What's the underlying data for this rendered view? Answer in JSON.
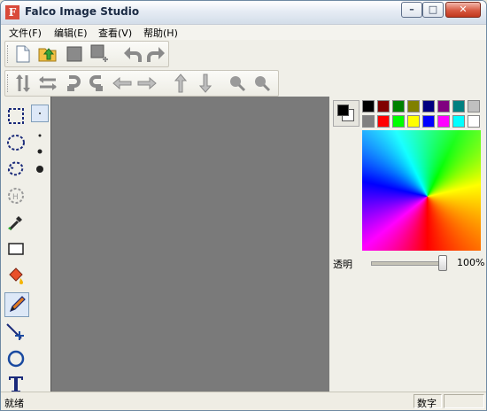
{
  "window": {
    "title": "Falco Image Studio",
    "minimize": "–",
    "maximize": "□",
    "close": "✕"
  },
  "menu": [
    "文件(F)",
    "编辑(E)",
    "查看(V)",
    "帮助(H)"
  ],
  "toolbar1": [
    "new-file-icon",
    "open-folder-icon",
    "save-icon",
    "save-as-icon",
    "undo-icon",
    "redo-icon"
  ],
  "toolbar2": [
    "flip-vertical-icon",
    "flip-horizontal-icon",
    "rotate-left-icon",
    "rotate-right-icon",
    "arrow-left-icon",
    "arrow-right-icon",
    "arrow-up-icon",
    "arrow-down-icon",
    "zoom-in-icon",
    "zoom-out-icon"
  ],
  "tools": [
    "rect-select-icon",
    "ellipse-select-icon",
    "lasso-select-icon",
    "magic-wand-icon",
    "eyedropper-icon",
    "rectangle-icon",
    "fill-bucket-icon",
    "pencil-icon",
    "line-icon",
    "ellipse-icon",
    "text-icon"
  ],
  "brush_sizes": [
    "brush-size-1",
    "brush-size-2",
    "brush-size-3",
    "brush-size-4"
  ],
  "palette": {
    "foreground": "#000000",
    "background": "#ffffff",
    "row1": [
      "#000000",
      "#800000",
      "#008000",
      "#808000",
      "#000080",
      "#800080",
      "#008080",
      "#c0c0c0"
    ],
    "row2": [
      "#808080",
      "#ff0000",
      "#00ff00",
      "#ffff00",
      "#0000ff",
      "#ff00ff",
      "#00ffff",
      "#ffffff"
    ],
    "opacity_label": "透明",
    "opacity_value": "100%",
    "opacity_fraction": 1.0
  },
  "status": {
    "text": "就绪",
    "mode": "数字"
  }
}
